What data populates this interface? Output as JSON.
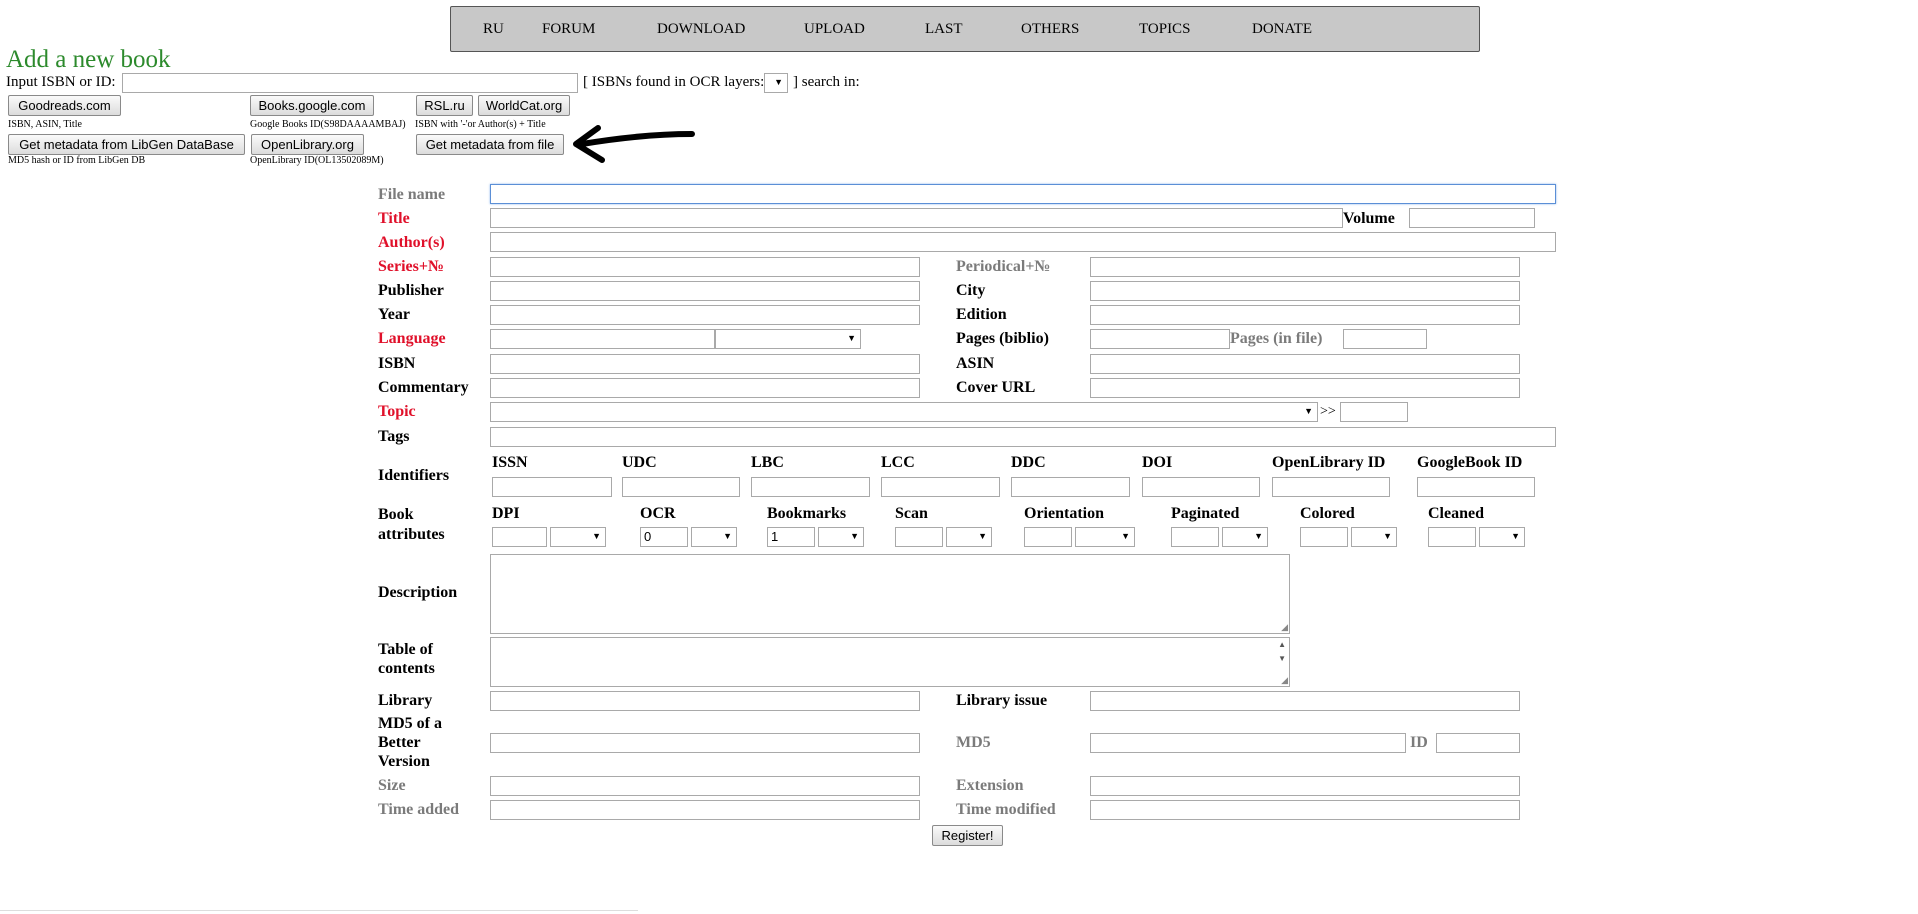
{
  "menu": {
    "items": [
      "RU",
      "FORUM",
      "DOWNLOAD",
      "UPLOAD",
      "LAST",
      "OTHERS",
      "TOPICS",
      "DONATE"
    ]
  },
  "header": {
    "title": "Add a new book",
    "isbn_label": "Input ISBN or ID:",
    "ocr_label": "[ ISBNs found in OCR layers:",
    "search_in_label": "] search in:"
  },
  "sources": {
    "goodreads": "Goodreads.com",
    "goodreads_hint": "ISBN, ASIN, Title",
    "google_books": "Books.google.com",
    "google_books_hint": "Google Books ID(S98DAAAAMBAJ)",
    "rsl": "RSL.ru",
    "worldcat": "WorldCat.org",
    "rsl_worldcat_hint": "ISBN with '-'or Author(s) + Title",
    "libgen_db": "Get metadata from LibGen DataBase",
    "libgen_db_hint": "MD5 hash or ID from LibGen DB",
    "openlibrary": "OpenLibrary.org",
    "openlibrary_hint": "OpenLibrary ID(OL13502089M)",
    "from_file": "Get metadata from file"
  },
  "form": {
    "file_name": "File name",
    "title": "Title",
    "volume": "Volume",
    "authors": "Author(s)",
    "series": "Series+№",
    "periodical": "Periodical+№",
    "publisher": "Publisher",
    "city": "City",
    "year": "Year",
    "edition": "Edition",
    "language": "Language",
    "pages_biblio": "Pages (biblio)",
    "pages_file": "Pages (in file)",
    "isbn": "ISBN",
    "asin": "ASIN",
    "commentary": "Commentary",
    "cover_url": "Cover URL",
    "topic": "Topic",
    "topic_suffix": ">>",
    "tags": "Tags",
    "identifiers": "Identifiers",
    "book_attributes_1": "Book",
    "book_attributes_2": "attributes",
    "description": "Description",
    "toc_1": "Table of",
    "toc_2": "contents",
    "library": "Library",
    "library_issue": "Library issue",
    "md5_better_1": "MD5 of a",
    "md5_better_2": "Better",
    "md5_better_3": "Version",
    "md5": "MD5",
    "id": "ID",
    "size": "Size",
    "extension": "Extension",
    "time_added": "Time added",
    "time_modified": "Time modified",
    "register": "Register!"
  },
  "identifiers": [
    "ISSN",
    "UDC",
    "LBC",
    "LCC",
    "DDC",
    "DOI",
    "OpenLibrary ID",
    "GoogleBook ID"
  ],
  "attributes": {
    "labels": [
      "DPI",
      "OCR",
      "Bookmarks",
      "Scan",
      "Orientation",
      "Paginated",
      "Colored",
      "Cleaned"
    ],
    "ocr_value": "0",
    "bookmarks_value": "1"
  },
  "colors": {
    "required": "#e0102a",
    "auto": "#7b7b7b",
    "title_green": "#2c8a2c",
    "menu_bg": "#c8c8c8"
  }
}
